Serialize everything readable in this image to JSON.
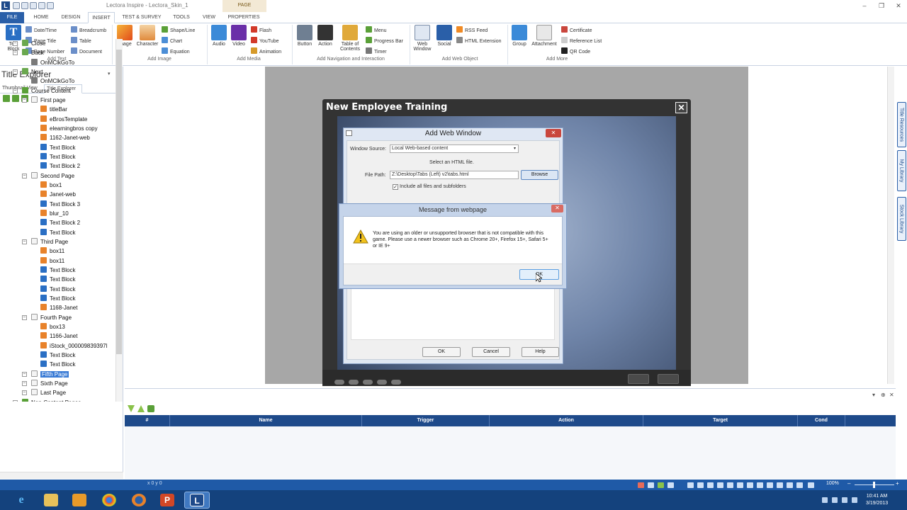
{
  "window": {
    "title": "Lectora Inspire - Lectora_Skin_1",
    "context_tab": "PAGE"
  },
  "ribbon_tabs": [
    "FILE",
    "HOME",
    "DESIGN",
    "INSERT",
    "TEST & SURVEY",
    "TOOLS",
    "VIEW",
    "PROPERTIES"
  ],
  "ribbon": {
    "text_block": "Text Block",
    "date_time": "Date/Time",
    "page_title": "Page Title",
    "page_number": "Page Number",
    "breadcrumb": "Breadcrumb",
    "table": "Table",
    "document": "Document",
    "add_text": "Add Text",
    "image": "Image",
    "character": "Character",
    "shape_line": "Shape/Line",
    "chart": "Chart",
    "equation": "Equation",
    "add_image": "Add Image",
    "audio": "Audio",
    "video": "Video",
    "flash": "Flash",
    "youtube": "YouTube",
    "animation": "Animation",
    "add_media": "Add Media",
    "button": "Button",
    "action": "Action",
    "table_of_contents": "Table of Contents",
    "menu": "Menu",
    "progress_bar": "Progress Bar",
    "timer": "Timer",
    "add_nav": "Add Navigation and Interaction",
    "web_window": "Web Window",
    "social": "Social",
    "rss_feed": "RSS Feed",
    "html_extension": "HTML Extension",
    "add_web_object": "Add Web Object",
    "group": "Group",
    "attachment": "Attachment",
    "certificate": "Certificate",
    "reference_list": "Reference List",
    "qr_code": "QR Code",
    "add_more": "Add More"
  },
  "left_pane": {
    "title": "Title Explorer",
    "tabs": [
      "Thumbnail View",
      "Title Explorer"
    ],
    "tree": [
      {
        "label": "Close",
        "type": "action",
        "indent": 1
      },
      {
        "label": "Back",
        "type": "action",
        "indent": 1
      },
      {
        "label": "OnMClkGoTo",
        "type": "onclick",
        "indent": 2
      },
      {
        "label": "Next",
        "type": "action",
        "indent": 1
      },
      {
        "label": "OnMClkGoTo",
        "type": "onclick",
        "indent": 2
      },
      {
        "label": "Course Content",
        "type": "folder",
        "indent": 1
      },
      {
        "label": "First page",
        "type": "page",
        "indent": 2
      },
      {
        "label": "titleBar",
        "type": "image",
        "indent": 3
      },
      {
        "label": "eBrosTemplate",
        "type": "image",
        "indent": 3
      },
      {
        "label": "elearningbros copy",
        "type": "image",
        "indent": 3
      },
      {
        "label": "1162-Janet-web",
        "type": "image",
        "indent": 3
      },
      {
        "label": "Text Block",
        "type": "text",
        "indent": 3
      },
      {
        "label": "Text Block",
        "type": "text",
        "indent": 3
      },
      {
        "label": "Text Block 2",
        "type": "text",
        "indent": 3
      },
      {
        "label": "Second Page",
        "type": "page",
        "indent": 2
      },
      {
        "label": "box1",
        "type": "image",
        "indent": 3
      },
      {
        "label": "Janet-web",
        "type": "image",
        "indent": 3
      },
      {
        "label": "Text Block 3",
        "type": "text",
        "indent": 3
      },
      {
        "label": "blur_10",
        "type": "image",
        "indent": 3
      },
      {
        "label": "Text Block 2",
        "type": "text",
        "indent": 3
      },
      {
        "label": "Text Block",
        "type": "text",
        "indent": 3
      },
      {
        "label": "Third Page",
        "type": "page",
        "indent": 2
      },
      {
        "label": "box11",
        "type": "image",
        "indent": 3
      },
      {
        "label": "box11",
        "type": "image",
        "indent": 3
      },
      {
        "label": "Text Block",
        "type": "text",
        "indent": 3
      },
      {
        "label": "Text Block",
        "type": "text",
        "indent": 3
      },
      {
        "label": "Text Block",
        "type": "text",
        "indent": 3
      },
      {
        "label": "Text Block",
        "type": "text",
        "indent": 3
      },
      {
        "label": "1168-Janet",
        "type": "image",
        "indent": 3
      },
      {
        "label": "Fourth Page",
        "type": "page",
        "indent": 2
      },
      {
        "label": "box13",
        "type": "image",
        "indent": 3
      },
      {
        "label": "1166-Janet",
        "type": "image",
        "indent": 3
      },
      {
        "label": "iStock_000009839397l",
        "type": "image",
        "indent": 3
      },
      {
        "label": "Text Block",
        "type": "text",
        "indent": 3
      },
      {
        "label": "Text Block",
        "type": "text",
        "indent": 3
      },
      {
        "label": "Fifth Page",
        "type": "page",
        "indent": 2,
        "selected": true
      },
      {
        "label": "Sixth Page",
        "type": "page",
        "indent": 2
      },
      {
        "label": "Last Page",
        "type": "page",
        "indent": 2
      },
      {
        "label": "Non-Content Pages",
        "type": "folder",
        "indent": 1
      }
    ]
  },
  "course": {
    "title": "New Employee Training",
    "close_glyph": "✕"
  },
  "web_window_dialog": {
    "title": "Add Web Window",
    "close_glyph": "✕",
    "window_source_label": "Window Source:",
    "window_source_value": "Local Web-based content",
    "select_html": "Select an HTML file.",
    "file_path_label": "File Path:",
    "file_path_value": "Z:\\Desktop\\Tabs (Left) v2\\tabs.html",
    "browse": "Browse",
    "include_label": "Include all files and subfolders",
    "ok": "OK",
    "cancel": "Cancel",
    "help": "Help"
  },
  "message_dialog": {
    "title": "Message from webpage",
    "close_glyph": "✕",
    "text": "You are using an older or unsupported browser that is not compatible with this game. Please use a newer browser such as Chrome 20+, Firefox 15+, Safari 5+ or IE 9+",
    "ok": "OK"
  },
  "right_tabs": [
    "Title Resources",
    "My Library",
    "Stock Library"
  ],
  "actions_grid": {
    "columns": [
      "#",
      "Name",
      "Trigger",
      "Action",
      "Target",
      "Cond"
    ]
  },
  "status": {
    "coords": "x 0 y 0",
    "zoom": "100%"
  },
  "taskbar": {
    "time": "10:41 AM",
    "date": "3/19/2013"
  },
  "colors": {
    "ribbon_blue": "#2a5fa8",
    "status_blue": "#1f5aa7",
    "taskbar": "#14427d",
    "grid_header": "#1e4a8a"
  }
}
